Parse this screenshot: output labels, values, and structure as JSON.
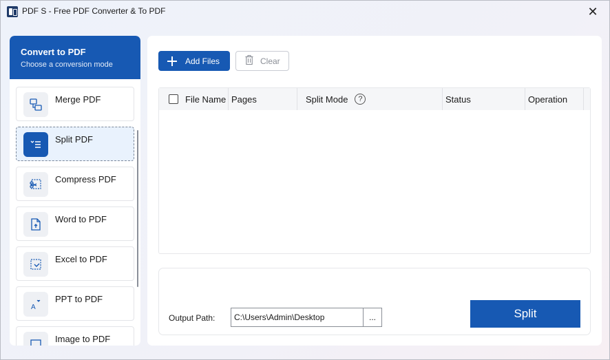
{
  "window": {
    "title": "PDF S - Free PDF Converter & To PDF",
    "close_glyph": "✕"
  },
  "sidebar": {
    "title": "Convert to PDF",
    "subtitle": "Choose a conversion mode",
    "items": [
      {
        "label": "Merge PDF",
        "icon": "merge-icon",
        "active": false
      },
      {
        "label": "Split PDF",
        "icon": "split-icon",
        "active": true
      },
      {
        "label": "Compress PDF",
        "icon": "compress-icon",
        "active": false
      },
      {
        "label": "Word to PDF",
        "icon": "word-icon",
        "active": false
      },
      {
        "label": "Excel to PDF",
        "icon": "excel-icon",
        "active": false
      },
      {
        "label": "PPT to PDF",
        "icon": "ppt-icon",
        "active": false
      },
      {
        "label": "Image to PDF",
        "icon": "image-icon",
        "active": false
      }
    ]
  },
  "toolbar": {
    "add_files_label": "Add Files",
    "clear_label": "Clear"
  },
  "table": {
    "columns": {
      "file_name": "File Name",
      "pages": "Pages",
      "split_mode": "Split Mode",
      "status": "Status",
      "operation": "Operation"
    },
    "help_glyph": "?"
  },
  "output": {
    "label": "Output Path:",
    "path": "C:\\Users\\Admin\\Desktop",
    "browse_label": "...",
    "action_label": "Split"
  },
  "colors": {
    "accent": "#1759b3",
    "active_item_bg": "#e9f2fd"
  }
}
